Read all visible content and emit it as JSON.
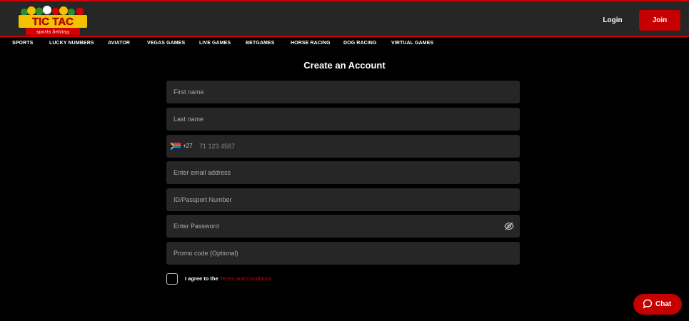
{
  "header": {
    "logo_text": "TIC TAC",
    "logo_subtext": "sports betting",
    "login_label": "Login",
    "join_label": "Join"
  },
  "nav": {
    "items": [
      {
        "label": "SPORTS"
      },
      {
        "label": "LUCKY NUMBERS"
      },
      {
        "label": "AVIATOR"
      },
      {
        "label": "VEGAS GAMES"
      },
      {
        "label": "LIVE GAMES"
      },
      {
        "label": "BETGAMES"
      },
      {
        "label": "HORSE RACING"
      },
      {
        "label": "DOG RACING"
      },
      {
        "label": "VIRTUAL GAMES"
      }
    ]
  },
  "form": {
    "title": "Create an Account",
    "first_name_placeholder": "First name",
    "last_name_placeholder": "Last name",
    "phone_dial_code": "+27",
    "phone_placeholder": "71 123 4567",
    "email_placeholder": "Enter email address",
    "id_placeholder": "ID/Passport Number",
    "password_placeholder": "Enter Password",
    "promo_placeholder": "Promo code (Optional)",
    "agree_text": "I agree to the",
    "terms_label": "Terms and Conditions"
  },
  "chat": {
    "label": "Chat"
  },
  "colors": {
    "accent": "#c40000",
    "topbar": "#262626",
    "field": "#262626",
    "background": "#000000"
  },
  "icons": {
    "flag": "south-africa-flag-icon",
    "password_toggle": "eye-slash-icon",
    "chat": "chat-bubble-icon"
  }
}
